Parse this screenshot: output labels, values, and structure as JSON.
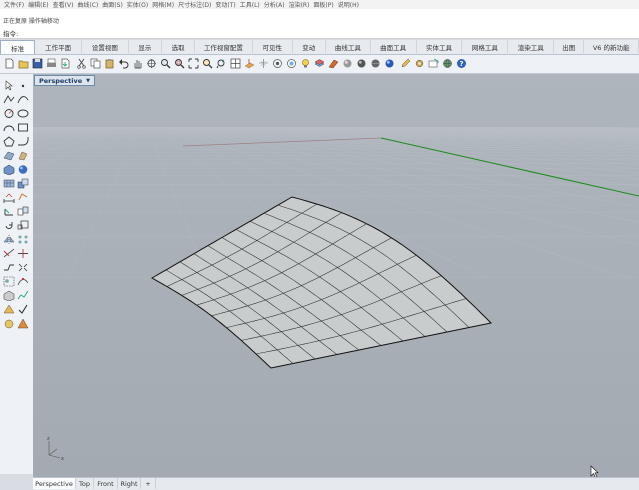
{
  "menu": [
    "文件(F)",
    "编辑(E)",
    "查看(V)",
    "曲线(C)",
    "曲面(S)",
    "实体(O)",
    "网格(M)",
    "尺寸标注(D)",
    "变动(T)",
    "工具(L)",
    "分析(A)",
    "渲染(R)",
    "面板(P)",
    "说明(H)"
  ],
  "command_history": [
    "正在复原 操作轴移动"
  ],
  "command_prompt": "指令:",
  "tabs": [
    "标准",
    "工作平面",
    "设置视图",
    "显示",
    "选取",
    "工作视窗配置",
    "可见性",
    "变动",
    "曲线工具",
    "曲面工具",
    "实体工具",
    "网格工具",
    "渲染工具",
    "出图",
    "V6 的新功能"
  ],
  "active_tab": 0,
  "viewport": {
    "title": "Perspective",
    "dropdown_icon": "triangle-down-icon"
  },
  "viewport_tabs": [
    "Perspective",
    "Top",
    "Front",
    "Right"
  ],
  "active_viewport_tab": 0,
  "viewport_tab_add_icon": "plus-icon",
  "axis_labels": {
    "z": "z",
    "x": "x"
  },
  "colors": {
    "grid_x_axis": "#7a2222",
    "grid_y_axis": "#1a8a1a",
    "surface": "#c9cccd",
    "viewport_bg": "#a7aeb5"
  }
}
